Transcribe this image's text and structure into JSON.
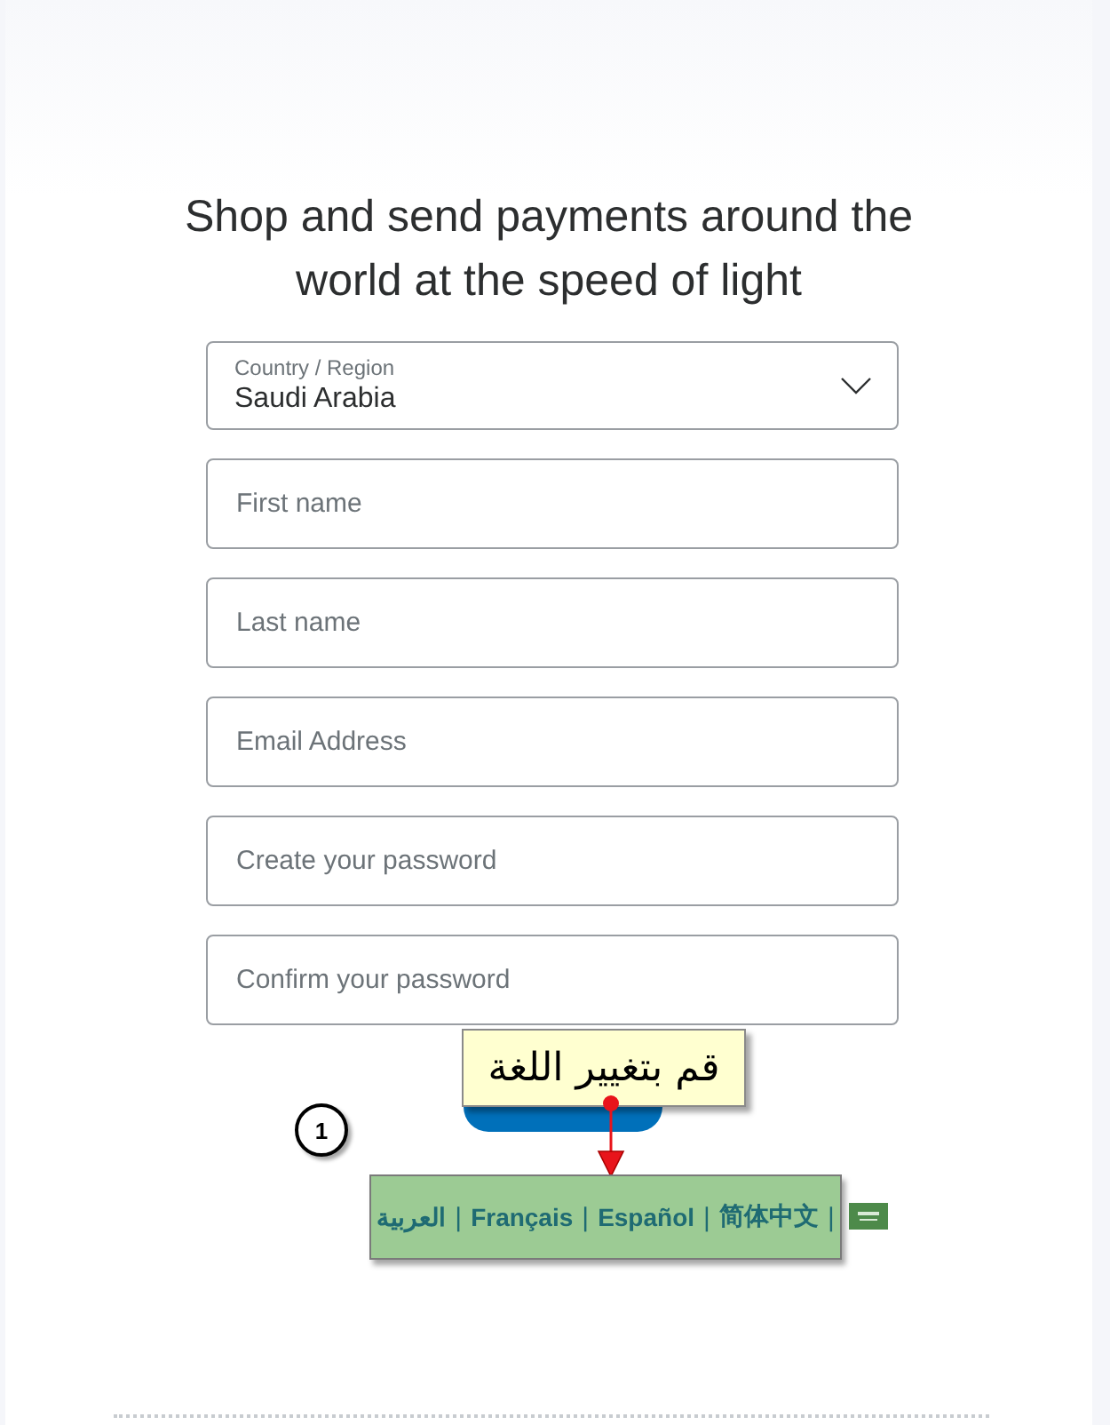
{
  "heading": "Shop and send payments around the world at the speed of light",
  "country": {
    "label": "Country / Region",
    "value": "Saudi Arabia"
  },
  "fields": [
    {
      "placeholder": "First name"
    },
    {
      "placeholder": "Last name"
    },
    {
      "placeholder": "Email Address"
    },
    {
      "placeholder": "Create your password"
    },
    {
      "placeholder": "Confirm your password"
    }
  ],
  "callout": "قم بتغيير اللغة",
  "step_number": "1",
  "languages": [
    "العربية",
    "Français",
    "Español",
    "简体中文"
  ],
  "separator": "|"
}
